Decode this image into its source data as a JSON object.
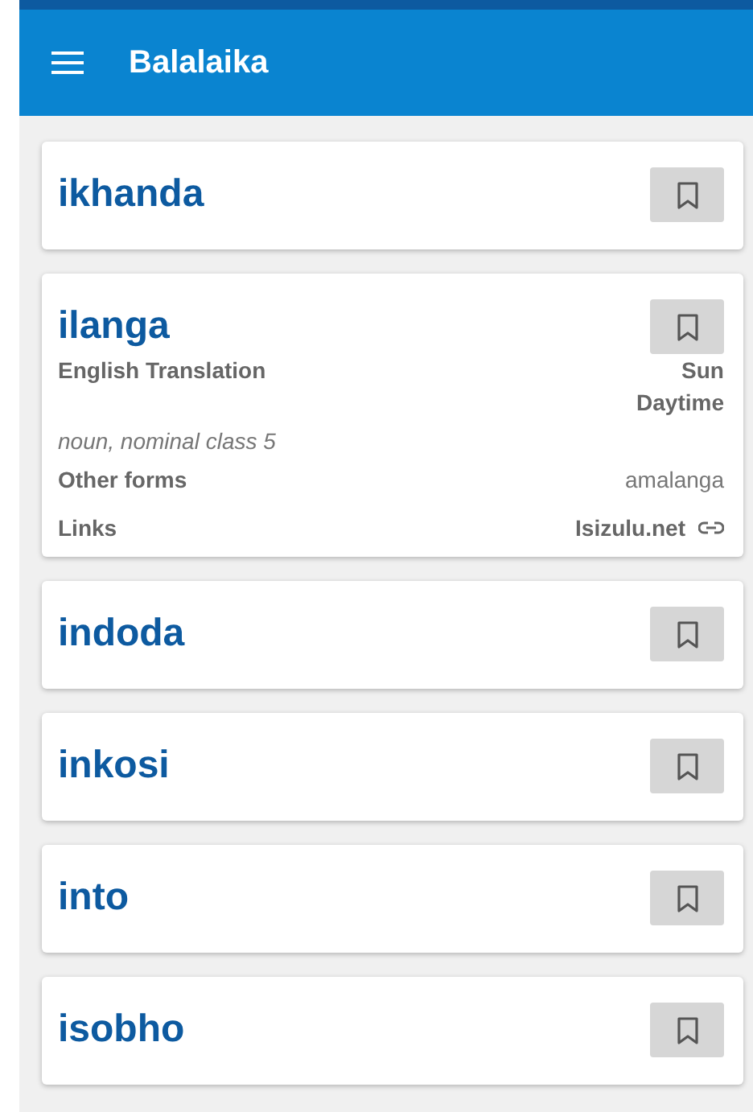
{
  "app_bar": {
    "title": "Balalaika"
  },
  "entries": [
    {
      "word": "ikhanda",
      "bookmarked": false
    },
    {
      "word": "ilanga",
      "bookmarked": false,
      "details": {
        "translation_label": "English Translation",
        "translations": [
          "Sun",
          "Daytime"
        ],
        "grammar": "noun, nominal class 5",
        "other_forms_label": "Other forms",
        "other_forms": "amalanga",
        "links_label": "Links",
        "link": "Isizulu.net"
      }
    },
    {
      "word": "indoda",
      "bookmarked": false
    },
    {
      "word": "inkosi",
      "bookmarked": false
    },
    {
      "word": "into",
      "bookmarked": false
    },
    {
      "word": "isobho",
      "bookmarked": false
    }
  ]
}
